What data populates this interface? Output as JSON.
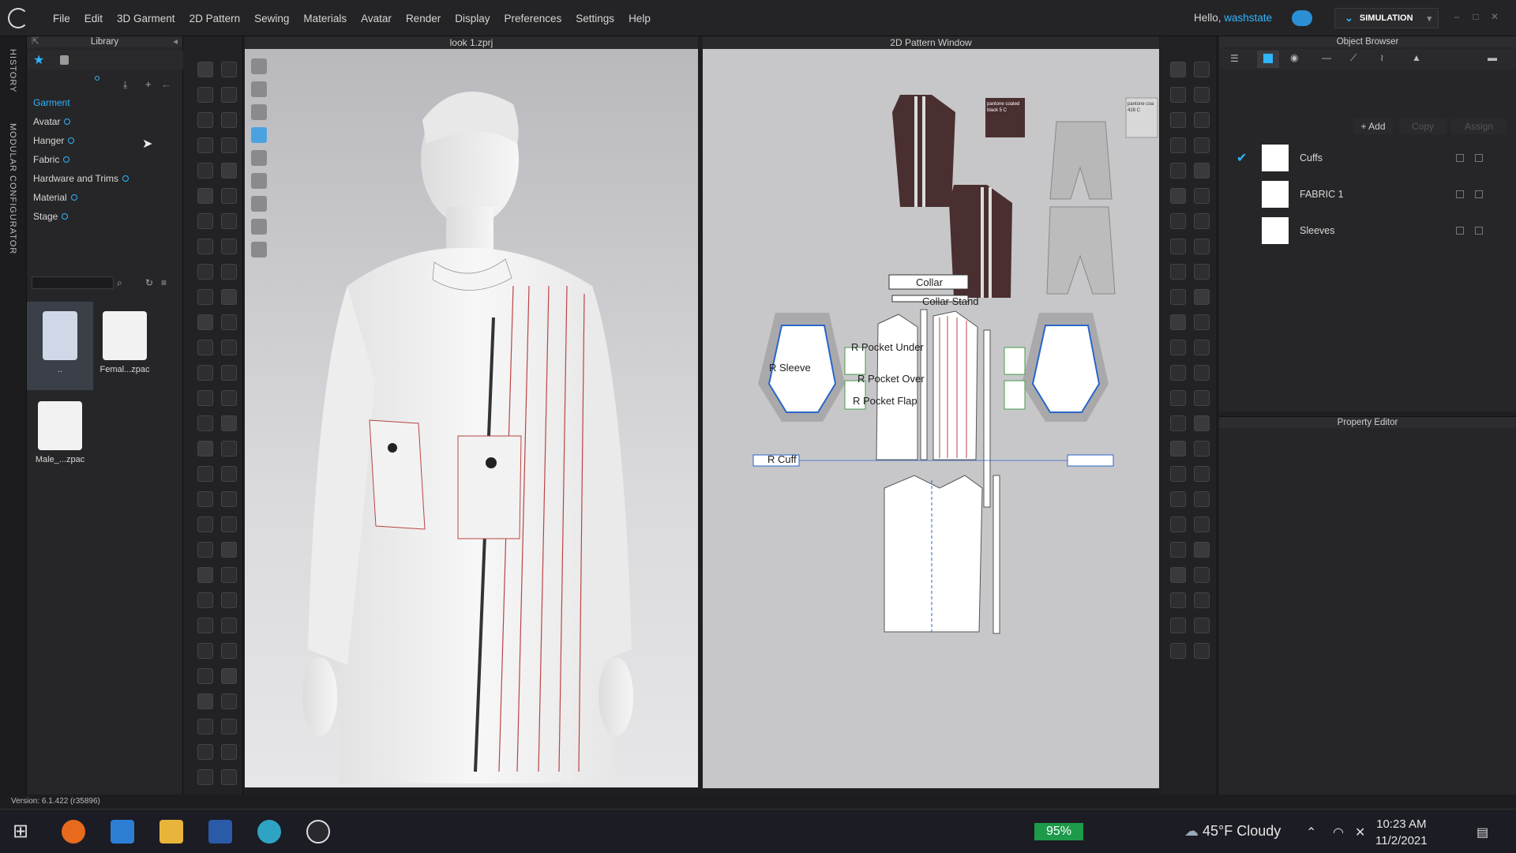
{
  "menubar": {
    "items": [
      "File",
      "Edit",
      "3D Garment",
      "2D Pattern",
      "Sewing",
      "Materials",
      "Avatar",
      "Render",
      "Display",
      "Preferences",
      "Settings",
      "Help"
    ],
    "greeting": "Hello,",
    "username": "washstate",
    "mode_button": "SIMULATION"
  },
  "side_tabs": {
    "history": "HISTORY",
    "modular": "MODULAR CONFIGURATOR"
  },
  "library": {
    "title": "Library",
    "tree": [
      {
        "label": "Garment",
        "active": true
      },
      {
        "label": "Avatar"
      },
      {
        "label": "Hanger"
      },
      {
        "label": "Fabric"
      },
      {
        "label": "Hardware and Trims"
      },
      {
        "label": "Material"
      },
      {
        "label": "Stage"
      }
    ],
    "files": [
      {
        "label": ".."
      },
      {
        "label": "Femal...zpac"
      },
      {
        "label": "Male_...zpac"
      }
    ]
  },
  "viewport3d": {
    "title": "look 1.zprj"
  },
  "pattern2d": {
    "title": "2D Pattern Window",
    "labels": {
      "collar": "Collar",
      "collar_stand": "Collar Stand",
      "r_sleeve": "R Sleeve",
      "r_pocket_under": "R Pocket Under",
      "r_pocket_over": "R Pocket Over",
      "r_pocket_flap": "R Pocket Flap",
      "r_cuff": "R Cuff",
      "swatch_note": "pantone coated black 5 C",
      "swatch_note2": "pantone coa 428 C"
    }
  },
  "object_browser": {
    "title": "Object Browser",
    "add": "+ Add",
    "copy": "Copy",
    "assign": "Assign",
    "fabrics": [
      {
        "name": "Cuffs",
        "checked": true
      },
      {
        "name": "FABRIC 1",
        "checked": false
      },
      {
        "name": "Sleeves",
        "checked": false
      }
    ]
  },
  "property_editor": {
    "title": "Property Editor"
  },
  "status": {
    "version": "Version: 6.1.422 (r35896)"
  },
  "taskbar": {
    "battery": "95%",
    "weather_temp": "45°F",
    "weather_desc": "Cloudy",
    "time": "10:23 AM",
    "date": "11/2/2021"
  },
  "colors": {
    "accent": "#2fb4ff",
    "panel": "#262628",
    "battery": "#1d9a4a"
  }
}
